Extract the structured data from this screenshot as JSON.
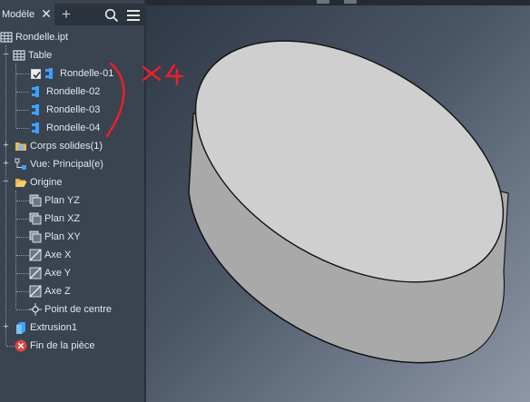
{
  "panel": {
    "tab_label": "Modèle",
    "tab_close_icon": "close-icon",
    "tab_add_icon": "plus-icon",
    "search_icon": "search-icon",
    "menu_icon": "hamburger-menu-icon"
  },
  "tree": {
    "root": "Rondelle.ipt",
    "table": "Table",
    "rows": [
      "Rondelle-01",
      "Rondelle-02",
      "Rondelle-03",
      "Rondelle-04"
    ],
    "solids": "Corps solides(1)",
    "view": "Vue: Principal(e)",
    "origin": "Origine",
    "origin_items": [
      "Plan YZ",
      "Plan XZ",
      "Plan XY",
      "Axe X",
      "Axe Y",
      "Axe Z",
      "Point de centre"
    ],
    "extrusion": "Extrusion1",
    "end": "Fin de la pièce"
  },
  "annotation": {
    "text": "×4",
    "color": "#e8202a"
  },
  "colors": {
    "panel_bg": "#3a4350",
    "accent_blue": "#3ea1ff",
    "folder_yellow": "#e9b94a",
    "error_red": "#e0453b"
  }
}
